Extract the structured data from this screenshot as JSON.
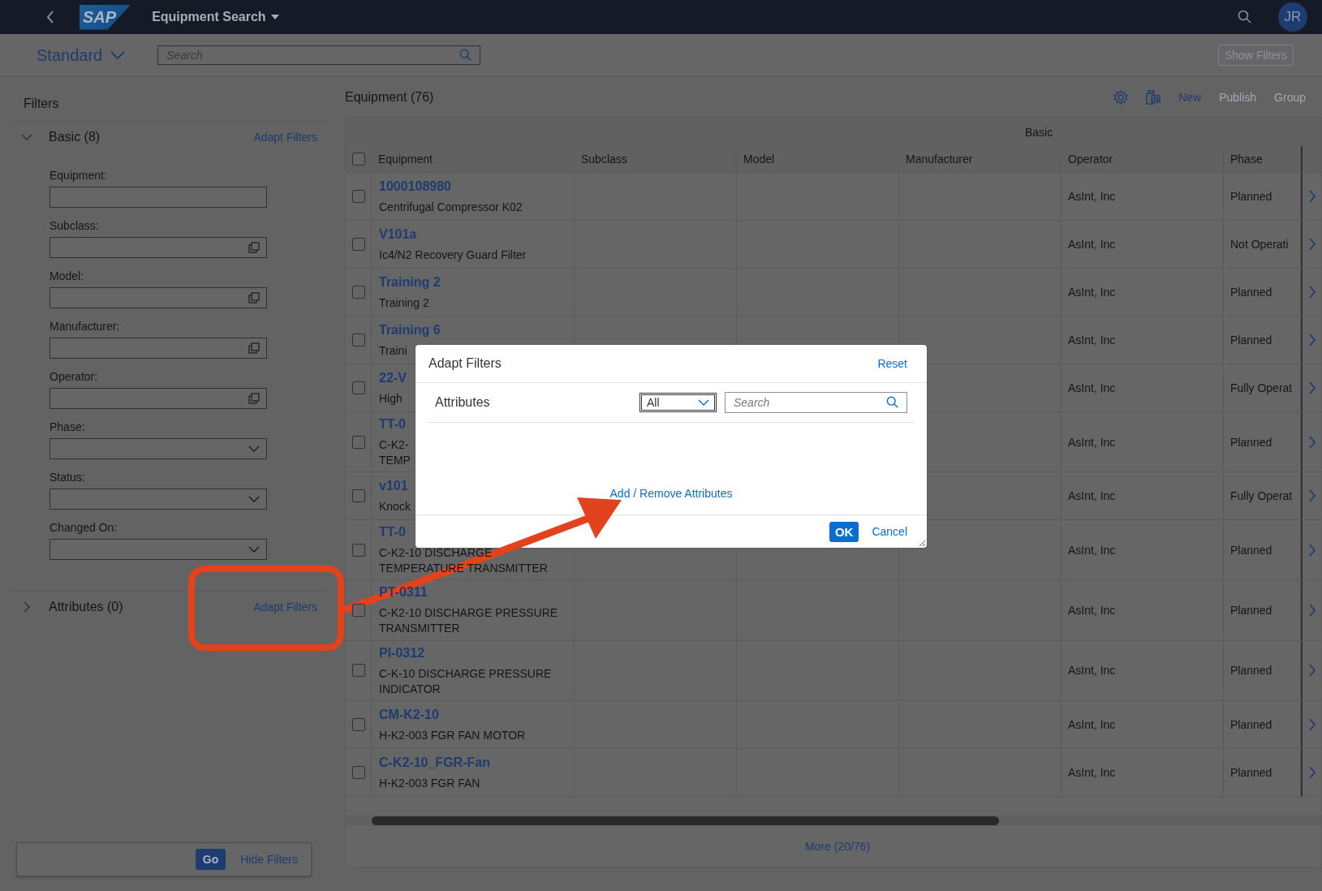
{
  "shell": {
    "logo": "SAP",
    "title": "Equipment Search",
    "user_initials": "JR"
  },
  "variant": {
    "name": "Standard",
    "search_placeholder": "Search",
    "show_filters": "Show Filters"
  },
  "filters": {
    "title": "Filters",
    "groups": [
      {
        "label": "Basic (8)",
        "expanded": true,
        "adapt_link": "Adapt Filters",
        "fields": [
          {
            "label": "Equipment:",
            "kind": "text"
          },
          {
            "label": "Subclass:",
            "kind": "valuehelp"
          },
          {
            "label": "Model:",
            "kind": "valuehelp"
          },
          {
            "label": "Manufacturer:",
            "kind": "valuehelp"
          },
          {
            "label": "Operator:",
            "kind": "valuehelp"
          },
          {
            "label": "Phase:",
            "kind": "dropdown"
          },
          {
            "label": "Status:",
            "kind": "dropdown"
          },
          {
            "label": "Changed On:",
            "kind": "dropdown"
          }
        ]
      },
      {
        "label": "Attributes (0)",
        "expanded": false,
        "adapt_link": "Adapt Filters"
      }
    ],
    "go": "Go",
    "hide": "Hide Filters"
  },
  "table": {
    "title": "Equipment (76)",
    "toolbar": [
      {
        "kind": "settings"
      },
      {
        "kind": "export"
      }
    ],
    "actions": [
      {
        "label": "New",
        "disabled": false
      },
      {
        "label": "Publish",
        "disabled": true
      },
      {
        "label": "Group",
        "disabled": true
      }
    ],
    "group_header": "Basic",
    "select_all_checked": false,
    "columns": [
      "Equipment",
      "Subclass",
      "Model",
      "Manufacturer",
      "Operator",
      "Phase"
    ],
    "rows": [
      {
        "checked": false,
        "id": "1000108980",
        "description": [
          "Centrifugal Compressor K02"
        ],
        "operator": "AsInt, Inc",
        "phase": "Planned"
      },
      {
        "checked": false,
        "id": "V101a",
        "description": [
          "Ic4/N2 Recovery Guard Filter"
        ],
        "operator": "AsInt, Inc",
        "phase": "Not Operati"
      },
      {
        "checked": false,
        "id": "Training 2",
        "description": [
          "Training 2"
        ],
        "operator": "AsInt, Inc",
        "phase": "Planned"
      },
      {
        "checked": false,
        "id": "Training 6",
        "description": [
          "Traini"
        ],
        "operator": "AsInt, Inc",
        "phase": "Planned"
      },
      {
        "checked": false,
        "id": "22-V",
        "description": [
          "High"
        ],
        "operator": "AsInt, Inc",
        "phase": "Fully Operat"
      },
      {
        "checked": false,
        "id": "TT-0",
        "description": [
          "C-K2-",
          "TEMP"
        ],
        "operator": "AsInt, Inc",
        "phase": "Planned"
      },
      {
        "checked": false,
        "id": "v101",
        "description": [
          "Knock"
        ],
        "operator": "AsInt, Inc",
        "phase": "Fully Operat"
      },
      {
        "checked": false,
        "id": "TT-0",
        "description": [
          "C-K2-10 DISCHARGE",
          "TEMPERATURE TRANSMITTER"
        ],
        "operator": "AsInt, Inc",
        "phase": "Planned"
      },
      {
        "checked": false,
        "id": "PT-0311",
        "description": [
          "C-K2-10 DISCHARGE PRESSURE",
          "TRANSMITTER"
        ],
        "operator": "AsInt, Inc",
        "phase": "Planned"
      },
      {
        "checked": false,
        "id": "PI-0312",
        "description": [
          "C-K-10 DISCHARGE PRESSURE",
          "INDICATOR"
        ],
        "operator": "AsInt, Inc",
        "phase": "Planned"
      },
      {
        "checked": false,
        "id": "CM-K2-10",
        "description": [
          "H-K2-003 FGR FAN MOTOR"
        ],
        "operator": "AsInt, Inc",
        "phase": "Planned"
      },
      {
        "checked": false,
        "id": "C-K2-10_FGR-Fan",
        "description": [
          "H-K2-003 FGR FAN"
        ],
        "operator": "AsInt, Inc",
        "phase": "Planned"
      }
    ],
    "more": "More (20/76)"
  },
  "dialog": {
    "title": "Adapt Filters",
    "reset": "Reset",
    "section": "Attributes",
    "select_value": "All",
    "search_placeholder": "Search",
    "link": "Add / Remove Attributes",
    "ok": "OK",
    "cancel": "Cancel"
  }
}
